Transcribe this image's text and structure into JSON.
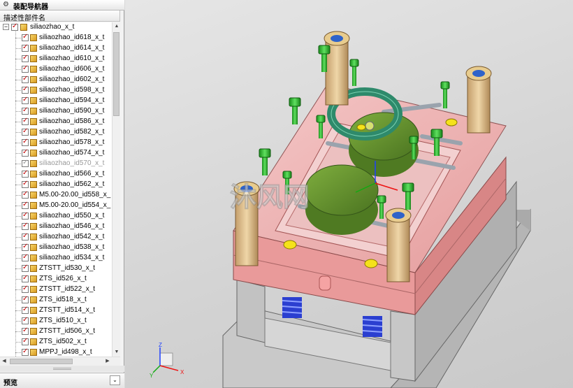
{
  "navigator": {
    "title": "装配导航器",
    "column_header": "描述性部件名",
    "root": "siliaozhao_x_t",
    "items": [
      {
        "label": "siliaozhao_id618_x_t",
        "checked": true
      },
      {
        "label": "siliaozhao_id614_x_t",
        "checked": true
      },
      {
        "label": "siliaozhao_id610_x_t",
        "checked": true
      },
      {
        "label": "siliaozhao_id606_x_t",
        "checked": true
      },
      {
        "label": "siliaozhao_id602_x_t",
        "checked": true
      },
      {
        "label": "siliaozhao_id598_x_t",
        "checked": true
      },
      {
        "label": "siliaozhao_id594_x_t",
        "checked": true
      },
      {
        "label": "siliaozhao_id590_x_t",
        "checked": true
      },
      {
        "label": "siliaozhao_id586_x_t",
        "checked": true
      },
      {
        "label": "siliaozhao_id582_x_t",
        "checked": true
      },
      {
        "label": "siliaozhao_id578_x_t",
        "checked": true
      },
      {
        "label": "siliaozhao_id574_x_t",
        "checked": true
      },
      {
        "label": "siliaozhao_id570_x_t",
        "checked": false
      },
      {
        "label": "siliaozhao_id566_x_t",
        "checked": true
      },
      {
        "label": "siliaozhao_id562_x_t",
        "checked": true
      },
      {
        "label": "M5.00-20.00_id558_x_",
        "checked": true
      },
      {
        "label": "M5.00-20.00_id554_x_",
        "checked": true
      },
      {
        "label": "siliaozhao_id550_x_t",
        "checked": true
      },
      {
        "label": "siliaozhao_id546_x_t",
        "checked": true
      },
      {
        "label": "siliaozhao_id542_x_t",
        "checked": true
      },
      {
        "label": "siliaozhao_id538_x_t",
        "checked": true
      },
      {
        "label": "siliaozhao_id534_x_t",
        "checked": true
      },
      {
        "label": "ZTSTT_id530_x_t",
        "checked": true
      },
      {
        "label": "ZTS_id526_x_t",
        "checked": true
      },
      {
        "label": "ZTSTT_id522_x_t",
        "checked": true
      },
      {
        "label": "ZTS_id518_x_t",
        "checked": true
      },
      {
        "label": "ZTSTT_id514_x_t",
        "checked": true
      },
      {
        "label": "ZTS_id510_x_t",
        "checked": true
      },
      {
        "label": "ZTSTT_id506_x_t",
        "checked": true
      },
      {
        "label": "ZTS_id502_x_t",
        "checked": true
      },
      {
        "label": "MPPJ_id498_x_t",
        "checked": true
      }
    ]
  },
  "preview": {
    "title": "预览"
  },
  "viewport": {
    "watermark": "沐风网",
    "triad": {
      "x": "X",
      "y": "Y",
      "z": "Z"
    },
    "colors": {
      "plate": "#f2b3b3",
      "green_part": "#5f8f2a",
      "teal_ring": "#2e8a6b",
      "bushing": "#d8b98a",
      "spring": "#2b3fd0",
      "bolt": "#29b32a",
      "base": "#c8c8c8"
    }
  }
}
